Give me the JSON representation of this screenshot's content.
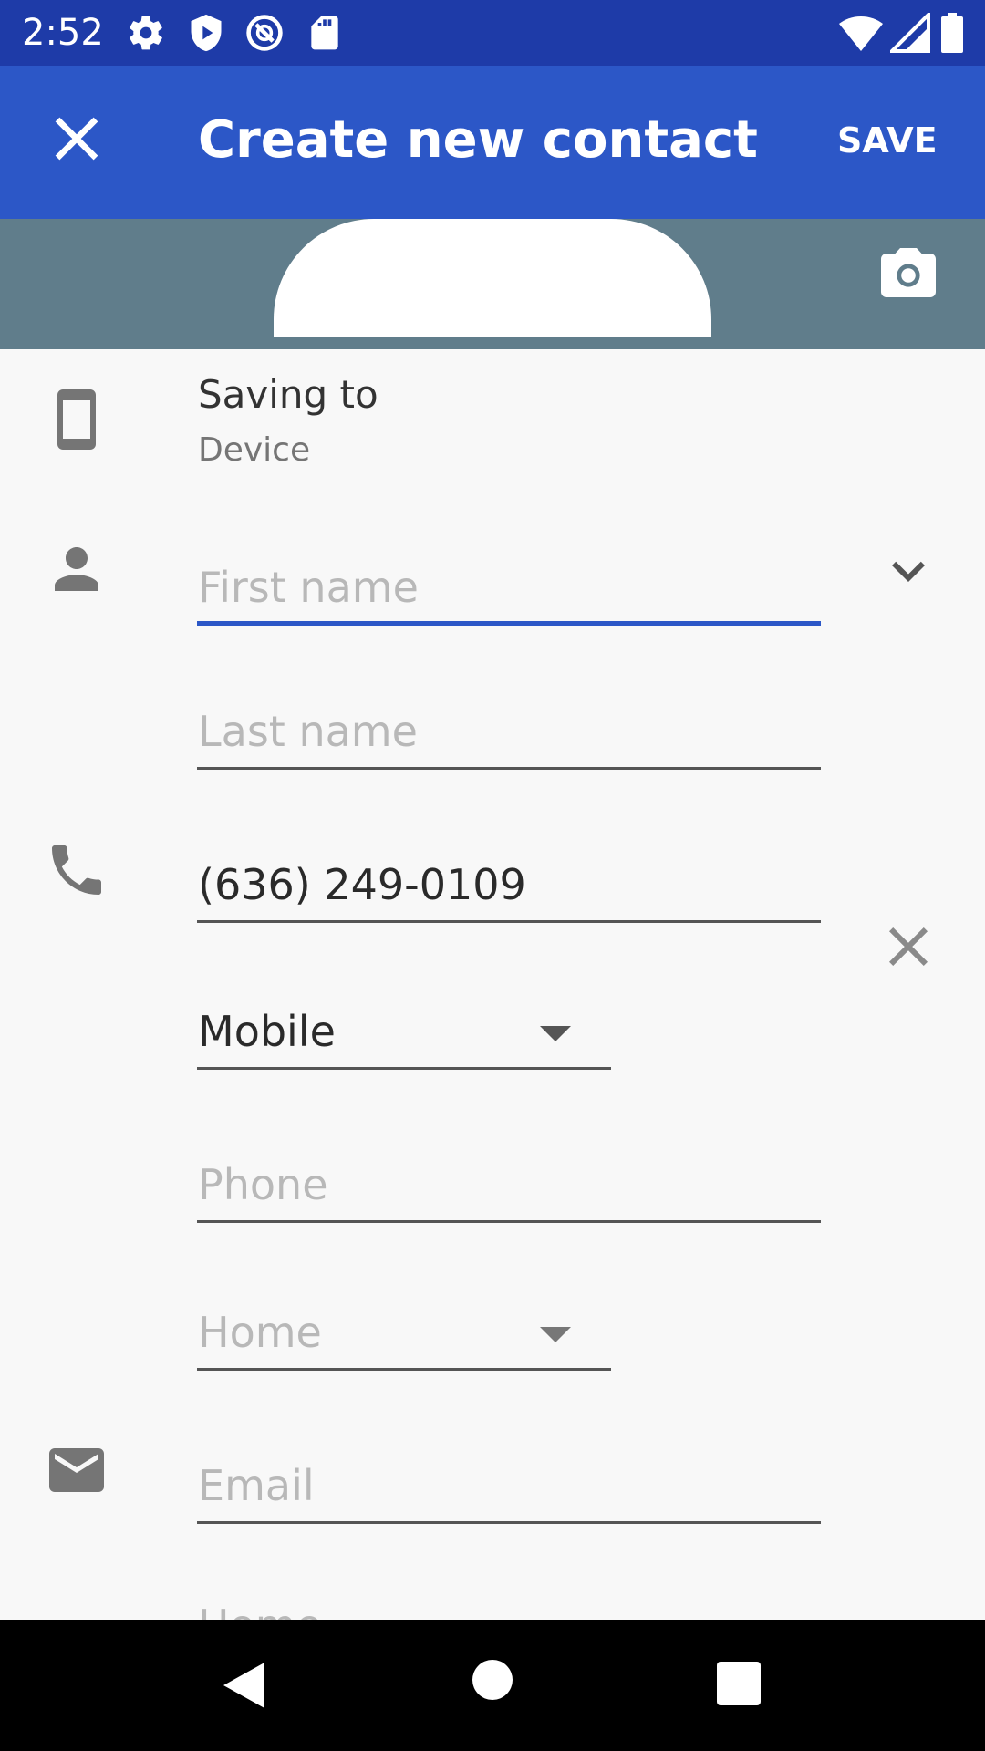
{
  "status_bar": {
    "time": "2:52",
    "icons": [
      "gear-icon",
      "shield-play-icon",
      "no-sync-icon",
      "sd-card-icon",
      "wifi-icon",
      "cell-signal-icon",
      "battery-icon"
    ]
  },
  "app_bar": {
    "title": "Create new contact",
    "save_label": "SAVE",
    "close_icon": "close-icon"
  },
  "header": {
    "camera_icon": "camera-icon",
    "colors": {
      "header_bg": "#607d8b",
      "app_bar_bg": "#2c57c7",
      "status_bar_bg": "#1e3ba8",
      "accent": "#2c57c7"
    }
  },
  "account": {
    "label": "Saving to",
    "value": "Device"
  },
  "name": {
    "first_placeholder": "First name",
    "last_placeholder": "Last name"
  },
  "phone": {
    "value": "(636) 249-0109",
    "type_selected": "Mobile",
    "new_placeholder": "Phone",
    "new_type": "Home"
  },
  "email": {
    "placeholder": "Email",
    "type": "Home"
  }
}
